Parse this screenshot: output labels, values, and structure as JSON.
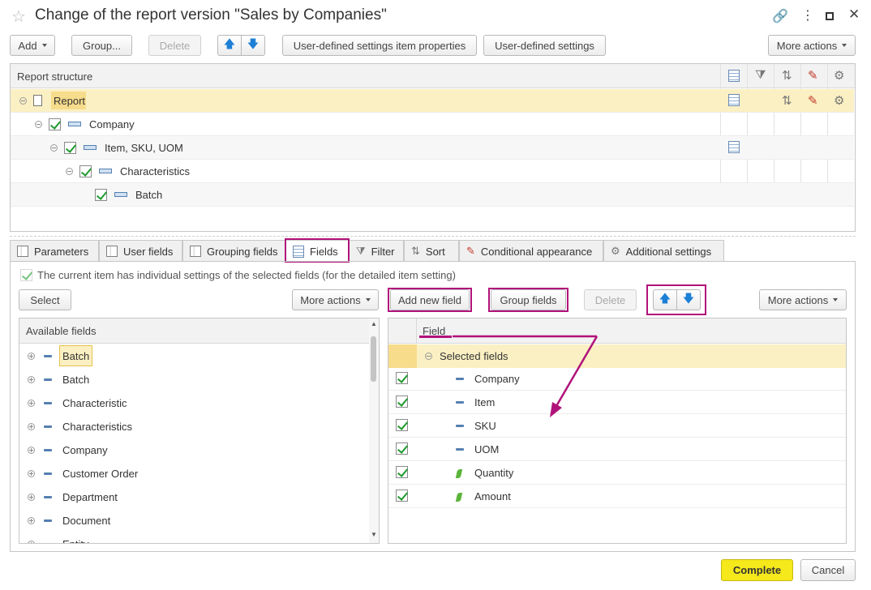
{
  "window": {
    "title": "Change of the report version \"Sales by Companies\""
  },
  "toolbar": {
    "add": "Add",
    "group": "Group...",
    "delete": "Delete",
    "udsip": "User-defined settings item properties",
    "uds": "User-defined settings",
    "more": "More actions"
  },
  "structure": {
    "header": "Report structure",
    "rows": [
      {
        "label": "Report"
      },
      {
        "label": "Company"
      },
      {
        "label": "Item, SKU, UOM"
      },
      {
        "label": "Characteristics"
      },
      {
        "label": "Batch"
      }
    ]
  },
  "tabs": [
    "Parameters",
    "User fields",
    "Grouping fields",
    "Fields",
    "Filter",
    "Sort",
    "Conditional appearance",
    "Additional settings"
  ],
  "fields_panel": {
    "individual_settings": "The current item has individual settings of the selected fields (for the detailed item setting)",
    "select": "Select",
    "more_left": "More actions",
    "add_new": "Add new field",
    "group_fields": "Group fields",
    "delete": "Delete",
    "more_right": "More actions",
    "available_header": "Available fields",
    "available": [
      "Batch",
      "Batch",
      "Characteristic",
      "Characteristics",
      "Company",
      "Customer Order",
      "Department",
      "Document",
      "Entity"
    ],
    "field_header": "Field",
    "selected_group": "Selected fields",
    "selected": [
      "Company",
      "Item",
      "SKU",
      "UOM",
      "Quantity",
      "Amount"
    ]
  },
  "footer": {
    "complete": "Complete",
    "cancel": "Cancel"
  },
  "colors": {
    "accent": "#b1127a",
    "highlight": "#fbf0c3",
    "complete": "#f5e81b"
  }
}
